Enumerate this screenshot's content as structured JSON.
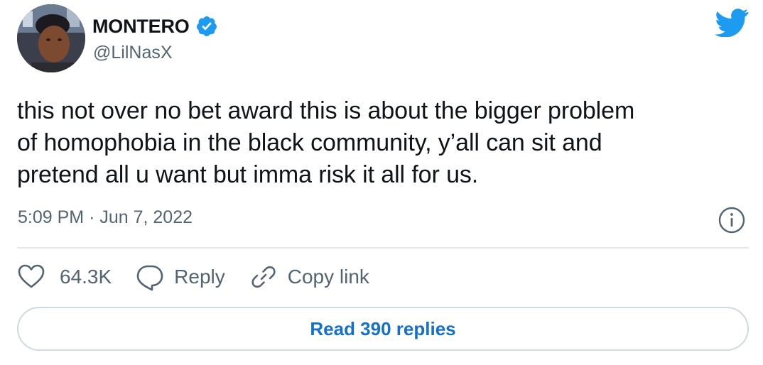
{
  "user": {
    "display_name": "MONTERO",
    "handle": "@LilNasX",
    "verified": true
  },
  "tweet": {
    "text": "this not over no bet award this is about the bigger problem\nof homophobia in the black community, y’all can sit and\npretend all u want but imma risk it all for us.",
    "time": "5:09 PM",
    "separator": "·",
    "date": "Jun 7, 2022"
  },
  "actions": {
    "like_count": "64.3K",
    "reply_label": "Reply",
    "copy_link_label": "Copy link"
  },
  "footer": {
    "read_replies_label": "Read 390 replies"
  },
  "icons": {
    "brand": "twitter-bird-icon",
    "verified": "verified-badge-icon",
    "info": "info-icon",
    "like": "heart-icon",
    "reply": "speech-bubble-icon",
    "copy_link": "link-icon"
  },
  "colors": {
    "accent": "#1d9bf0",
    "link_text": "#1570c9",
    "text_primary": "#0f1419",
    "text_secondary": "#536471",
    "border": "#cfd9de"
  }
}
